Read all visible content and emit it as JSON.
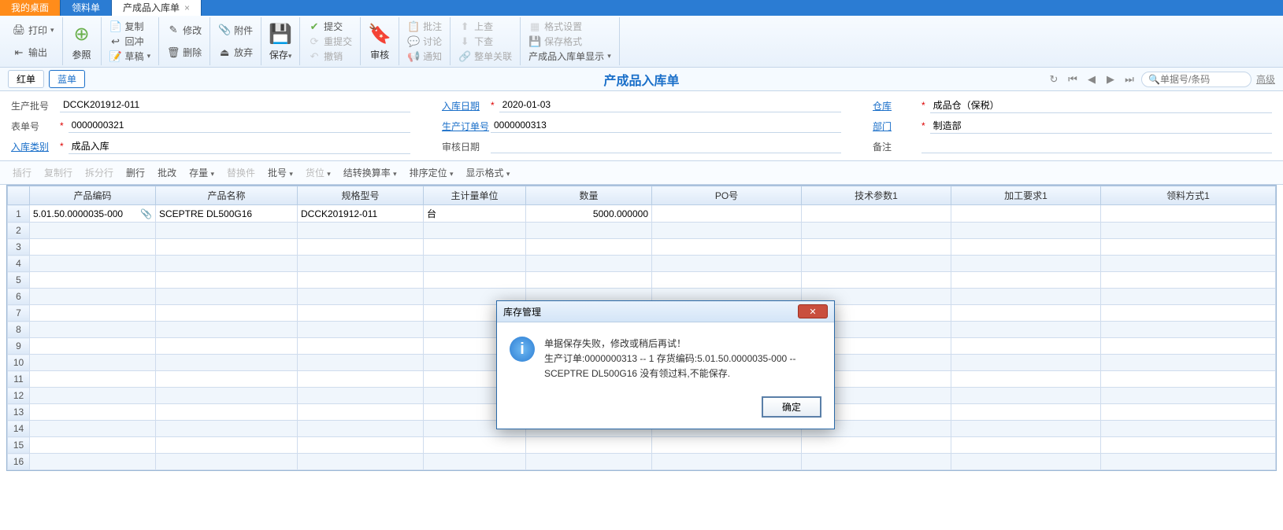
{
  "tabs": {
    "t0": "我的桌面",
    "t1": "领料单",
    "t2": "产成品入库单"
  },
  "ribbon": {
    "print": "打印",
    "export": "输出",
    "ref": "参照",
    "copy": "复制",
    "red": "回冲",
    "draft": "草稿",
    "modify": "修改",
    "delete": "删除",
    "attach": "附件",
    "discard": "放弃",
    "save": "保存",
    "submit": "提交",
    "resubmit": "重提交",
    "revoke": "撤销",
    "audit": "审核",
    "approve": "批注",
    "discuss": "讨论",
    "notify": "通知",
    "up": "上查",
    "down": "下查",
    "link": "整单关联",
    "format": "格式设置",
    "saveformat": "保存格式",
    "display": "产成品入库单显示"
  },
  "doctype": {
    "red": "红单",
    "blue": "蓝单",
    "title": "产成品入库单",
    "search_ph": "单据号/条码",
    "advanced": "高级"
  },
  "form": {
    "batch_l": "生产批号",
    "batch_v": "DCCK201912-011",
    "docno_l": "表单号",
    "docno_v": "0000000321",
    "cat_l": "入库类别",
    "cat_v": "成品入库",
    "date_l": "入库日期",
    "date_v": "2020-01-03",
    "order_l": "生产订单号",
    "order_v": "0000000313",
    "audate_l": "审核日期",
    "audate_v": "",
    "wh_l": "仓库",
    "wh_v": "成品仓（保税）",
    "dept_l": "部门",
    "dept_v": "制造部",
    "note_l": "备注",
    "note_v": ""
  },
  "gridtb": {
    "ins": "插行",
    "copy": "复制行",
    "split": "拆分行",
    "del": "删行",
    "batch": "批改",
    "stock": "存量",
    "rep": "替换件",
    "lot": "批号",
    "loc": "货位",
    "conv": "结转换算率",
    "sort": "排序定位",
    "fmt": "显示格式"
  },
  "cols": {
    "c1": "产品编码",
    "c2": "产品名称",
    "c3": "规格型号",
    "c4": "主计量单位",
    "c5": "数量",
    "c6": "PO号",
    "c7": "技术参数1",
    "c8": "加工要求1",
    "c9": "领料方式1"
  },
  "row": {
    "code": "5.01.50.0000035-000",
    "name": "SCEPTRE DL500G16",
    "spec": "DCCK201912-011",
    "uom": "台",
    "qty": "5000.000000"
  },
  "dialog": {
    "title": "库存管理",
    "line1": "单据保存失败，修改或稍后再试！",
    "line2": "生产订单:0000000313 -- 1 存货编码:5.01.50.0000035-000 -- SCEPTRE DL500G16 没有领过料,不能保存.",
    "ok": "确定"
  }
}
